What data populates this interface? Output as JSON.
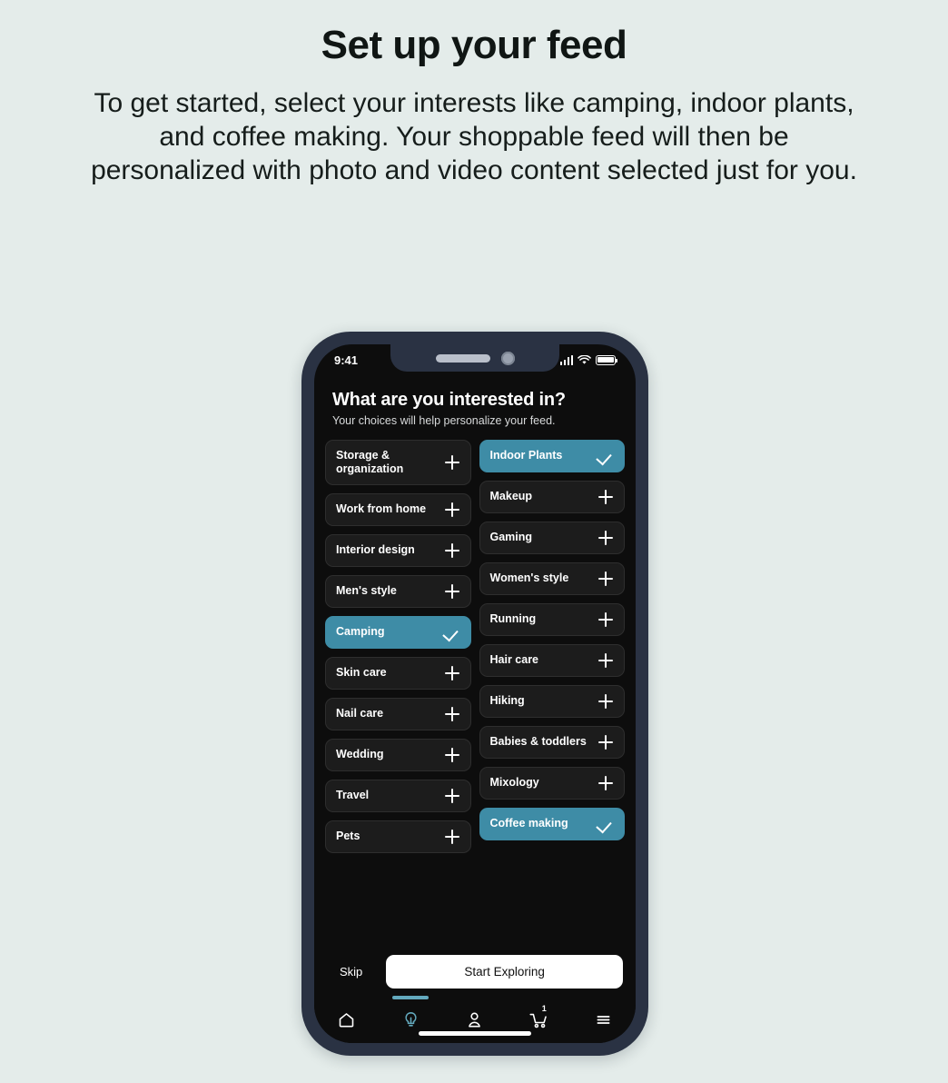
{
  "intro": {
    "title": "Set up your feed",
    "body": "To get started, select your interests like camping, indoor plants, and coffee making. Your shoppable feed will then be personalized with photo and video content selected just for you."
  },
  "colors": {
    "page_background": "#e4ecea",
    "phone_frame": "#2a3243",
    "screen_background": "#0d0d0d",
    "chip_background": "#1c1c1c",
    "accent_teal": "#3e8ca6",
    "active_tab_indicator": "#63a9bd",
    "primary_button_background": "#ffffff"
  },
  "phone": {
    "status_bar": {
      "time": "9:41",
      "signal_icon": "cellular-signal-icon",
      "wifi_icon": "wifi-icon",
      "battery_icon": "battery-icon"
    },
    "screen": {
      "title": "What are you interested in?",
      "subtitle": "Your choices will help personalize your feed.",
      "chips": {
        "left_column": [
          {
            "label": "Storage & organization",
            "selected": false,
            "icon": "plus-icon",
            "two_line": true
          },
          {
            "label": "Work from home",
            "selected": false,
            "icon": "plus-icon"
          },
          {
            "label": "Interior design",
            "selected": false,
            "icon": "plus-icon"
          },
          {
            "label": "Men's style",
            "selected": false,
            "icon": "plus-icon"
          },
          {
            "label": "Camping",
            "selected": true,
            "icon": "check-icon"
          },
          {
            "label": "Skin care",
            "selected": false,
            "icon": "plus-icon"
          },
          {
            "label": "Nail care",
            "selected": false,
            "icon": "plus-icon"
          },
          {
            "label": "Wedding",
            "selected": false,
            "icon": "plus-icon"
          },
          {
            "label": "Travel",
            "selected": false,
            "icon": "plus-icon"
          },
          {
            "label": "Pets",
            "selected": false,
            "icon": "plus-icon"
          }
        ],
        "right_column": [
          {
            "label": "Indoor Plants",
            "selected": true,
            "icon": "check-icon"
          },
          {
            "label": "Makeup",
            "selected": false,
            "icon": "plus-icon"
          },
          {
            "label": "Gaming",
            "selected": false,
            "icon": "plus-icon"
          },
          {
            "label": "Women's style",
            "selected": false,
            "icon": "plus-icon"
          },
          {
            "label": "Running",
            "selected": false,
            "icon": "plus-icon"
          },
          {
            "label": "Hair care",
            "selected": false,
            "icon": "plus-icon"
          },
          {
            "label": "Hiking",
            "selected": false,
            "icon": "plus-icon"
          },
          {
            "label": "Babies & toddlers",
            "selected": false,
            "icon": "plus-icon"
          },
          {
            "label": "Mixology",
            "selected": false,
            "icon": "plus-icon"
          },
          {
            "label": "Coffee making",
            "selected": true,
            "icon": "check-icon"
          }
        ]
      },
      "footer": {
        "skip_label": "Skip",
        "primary_label": "Start Exploring"
      },
      "tab_bar": [
        {
          "name": "home",
          "icon": "home-icon",
          "active": false
        },
        {
          "name": "inspire",
          "icon": "lightbulb-icon",
          "active": true
        },
        {
          "name": "account",
          "icon": "person-icon",
          "active": false
        },
        {
          "name": "cart",
          "icon": "shopping-cart-icon",
          "active": false,
          "badge": "1"
        },
        {
          "name": "menu",
          "icon": "hamburger-menu-icon",
          "active": false
        }
      ]
    }
  }
}
